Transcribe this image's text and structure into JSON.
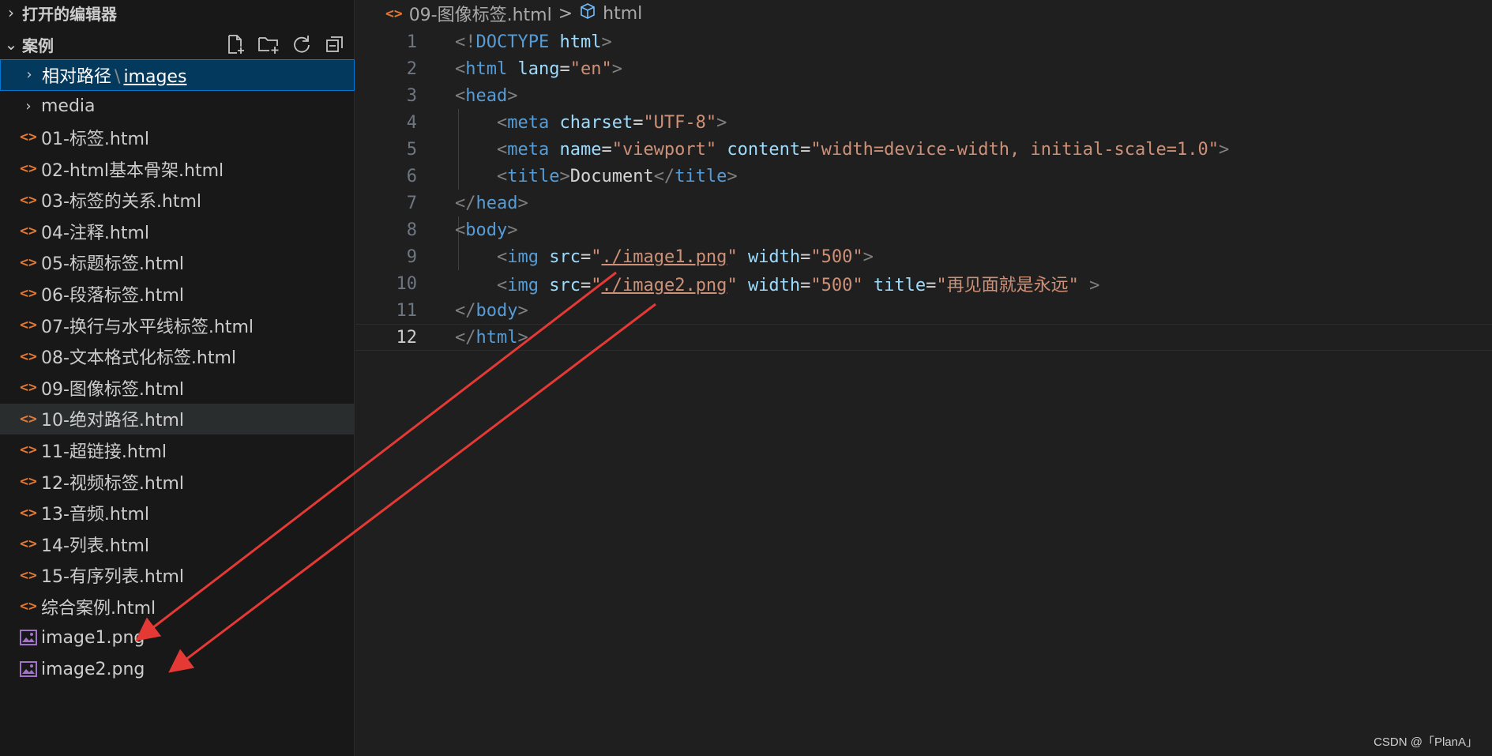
{
  "explorer": {
    "open_editors_label": "打开的编辑器",
    "workspace_label": "案例",
    "actions": [
      "new-file-icon",
      "new-folder-icon",
      "refresh-icon",
      "collapse-all-icon"
    ]
  },
  "tree": {
    "selected_folder": {
      "part1": "相对路径",
      "sep": "\\",
      "part2": "images"
    },
    "media": "media",
    "files": [
      "01-标签.html",
      "02-html基本骨架.html",
      "03-标签的关系.html",
      "04-注释.html",
      "05-标题标签.html",
      "06-段落标签.html",
      "07-换行与水平线标签.html",
      "08-文本格式化标签.html",
      "09-图像标签.html",
      "10-绝对路径.html",
      "11-超链接.html",
      "12-视频标签.html",
      "13-音频.html",
      "14-列表.html",
      "15-有序列表.html",
      "综合案例.html"
    ],
    "images": [
      "image1.png",
      "image2.png"
    ],
    "hovered_file": "10-绝对路径.html"
  },
  "breadcrumb": {
    "file": "09-图像标签.html",
    "separator": ">",
    "symbol": "html"
  },
  "code": {
    "line_numbers": [
      "1",
      "2",
      "3",
      "4",
      "5",
      "6",
      "7",
      "8",
      "9",
      "10",
      "11",
      "12"
    ],
    "active_line": "12",
    "l1": {
      "open": "<!",
      "tag": "DOCTYPE",
      "sp": " ",
      "attr": "html",
      "close": ">"
    },
    "l2": {
      "open": "<",
      "tag": "html",
      "sp": " ",
      "attr": "lang",
      "eq": "=",
      "val": "\"en\"",
      "close": ">"
    },
    "l3": {
      "open": "<",
      "tag": "head",
      "close": ">"
    },
    "l4": {
      "indent": "    ",
      "open": "<",
      "tag": "meta",
      "sp": " ",
      "attr": "charset",
      "eq": "=",
      "val": "\"UTF-8\"",
      "close": ">"
    },
    "l5": {
      "indent": "    ",
      "open": "<",
      "tag": "meta",
      "sp": " ",
      "attr1": "name",
      "eq1": "=",
      "val1": "\"viewport\"",
      "sp2": " ",
      "attr2": "content",
      "eq2": "=",
      "val2": "\"width=device-width, initial-scale=1.0\"",
      "close": ">"
    },
    "l6": {
      "indent": "    ",
      "open": "<",
      "tag": "title",
      "close": ">",
      "text": "Document",
      "open2": "</",
      "tag2": "title",
      "close2": ">"
    },
    "l7": {
      "open": "</",
      "tag": "head",
      "close": ">"
    },
    "l8": {
      "open": "<",
      "tag": "body",
      "close": ">"
    },
    "l9": {
      "indent": "    ",
      "open": "<",
      "tag": "img",
      "sp": " ",
      "attr1": "src",
      "eq1": "=",
      "q1": "\"",
      "path": "./image1.png",
      "q2": "\"",
      "sp2": " ",
      "attr2": "width",
      "eq2": "=",
      "val2": "\"500\"",
      "close": ">"
    },
    "l10": {
      "indent": "    ",
      "open": "<",
      "tag": "img",
      "sp": " ",
      "attr1": "src",
      "eq1": "=",
      "q1": "\"",
      "path": "./image2.png",
      "q2": "\"",
      "sp2": " ",
      "attr2": "width",
      "eq2": "=",
      "val2": "\"500\"",
      "sp3": " ",
      "attr3": "title",
      "eq3": "=",
      "val3": "\"再见面就是永远\"",
      "close": " >"
    },
    "l11": {
      "open": "</",
      "tag": "body",
      "close": ">"
    },
    "l12": {
      "open": "</",
      "tag": "html",
      "close": ">"
    }
  },
  "colors": {
    "accent": "#0078d4",
    "selected_bg": "#04395e",
    "annotation_arrow": "#e53935",
    "html_icon": "#e37933",
    "image_icon": "#a074c4"
  },
  "watermark": "CSDN @「PlanA」"
}
